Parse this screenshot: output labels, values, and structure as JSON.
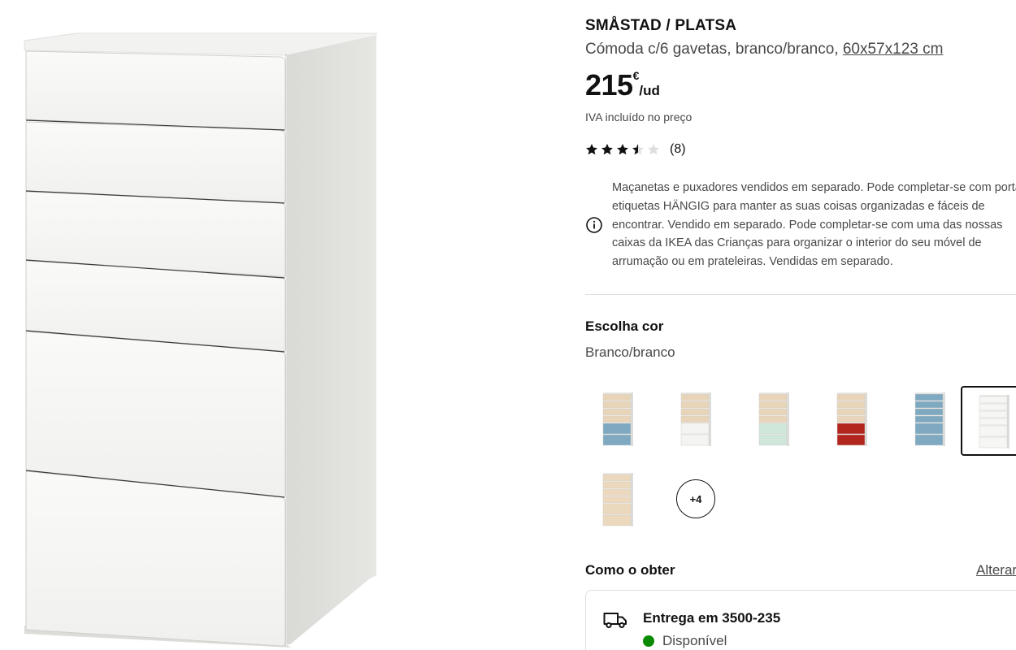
{
  "product": {
    "name": "SMÅSTAD / PLATSA",
    "description_prefix": "Cómoda c/6 gavetas, branco/branco, ",
    "dimensions": "60x57x123 cm",
    "price_amount": "215",
    "price_currency": "€",
    "price_unit": "/ud",
    "vat_note": "IVA incluído no preço",
    "rating_value": 3.5,
    "rating_max": 5,
    "rating_count": "(8)",
    "notice": "Maçanetas e puxadores vendidos em separado. Pode completar-se com porta-etiquetas HÄNGIG para manter as suas coisas organizadas e fáceis de encontrar. Vendido em separado. Pode completar-se com uma das nossas caixas da IKEA das Crianças para organizar o interior do seu móvel de arrumação ou em prateleiras. Vendidas em separado."
  },
  "color_picker": {
    "heading": "Escolha cor",
    "selected_label": "Branco/branco",
    "swatches": [
      {
        "name": "birch-blue",
        "fronts": [
          "#e8d4b8",
          "#e8d4b8",
          "#e8d4b8",
          "#e8d4b8",
          "#7fa9c0",
          "#7fa9c0"
        ]
      },
      {
        "name": "birch-white",
        "fronts": [
          "#e8d4b8",
          "#e8d4b8",
          "#e8d4b8",
          "#e8d4b8",
          "#f4f4f2",
          "#f4f4f2"
        ]
      },
      {
        "name": "birch-mint",
        "fronts": [
          "#e8d4b8",
          "#e8d4b8",
          "#e8d4b8",
          "#e8d4b8",
          "#cfe6da",
          "#cfe6da"
        ]
      },
      {
        "name": "birch-red",
        "fronts": [
          "#e8d4b8",
          "#e8d4b8",
          "#e8d4b8",
          "#e8d4b8",
          "#b3261e",
          "#b3261e"
        ]
      },
      {
        "name": "white-blue",
        "fronts": [
          "#7fa9c0",
          "#7fa9c0",
          "#7fa9c0",
          "#7fa9c0",
          "#7fa9c0",
          "#7fa9c0"
        ]
      },
      {
        "name": "white-white",
        "fronts": [
          "#f6f6f4",
          "#f6f6f4",
          "#f6f6f4",
          "#f6f6f4",
          "#f6f6f4",
          "#f6f6f4"
        ],
        "selected": true
      },
      {
        "name": "birch-birch",
        "fronts": [
          "#ecd8bd",
          "#ecd8bd",
          "#ecd8bd",
          "#ecd8bd",
          "#ecd8bd",
          "#ecd8bd"
        ]
      }
    ],
    "more_label": "+4"
  },
  "availability": {
    "heading": "Como o obter",
    "change_label": "Alterar",
    "delivery_title": "Entrega em 3500-235",
    "status": "Disponível",
    "status_color": "#0a8a00"
  },
  "icons": {
    "info": "info-icon",
    "delivery": "truck-icon",
    "star": "star-icon"
  }
}
